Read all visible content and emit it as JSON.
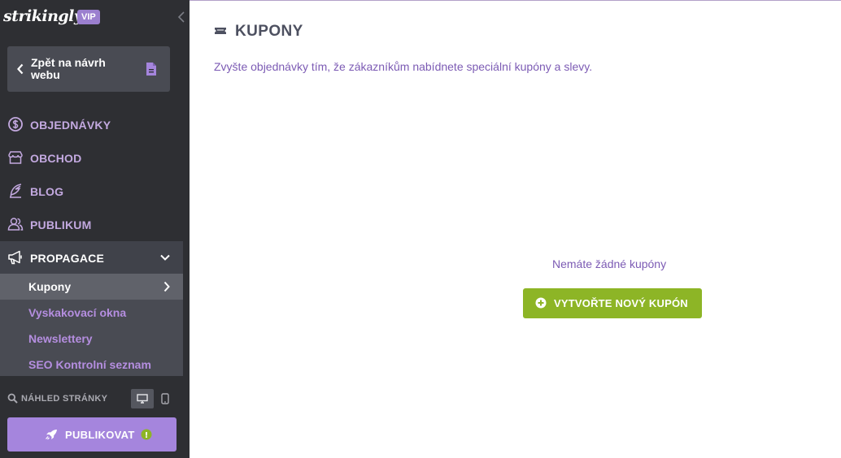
{
  "colors": {
    "sidebar_bg": "#2e2f33",
    "accent_purple": "#a585dd",
    "nav_text": "#c3a9e0",
    "create_button": "#8db526",
    "body_text_purple": "#7c5bb4"
  },
  "sidebar": {
    "logo": "strikingly",
    "badge": "VIP",
    "back_button": {
      "label": "Zpět na návrh webu",
      "icon": "page-icon"
    },
    "nav": [
      {
        "label": "OBJEDNÁVKY",
        "icon": "dollar-circle-icon"
      },
      {
        "label": "OBCHOD",
        "icon": "store-icon"
      },
      {
        "label": "BLOG",
        "icon": "feather-icon"
      },
      {
        "label": "PUBLIKUM",
        "icon": "users-icon"
      },
      {
        "label": "PROPAGACE",
        "icon": "megaphone-icon",
        "expanded": true
      }
    ],
    "submenu": [
      {
        "label": "Kupony",
        "active": true
      },
      {
        "label": "Vyskakovací okna"
      },
      {
        "label": "Newslettery"
      },
      {
        "label": "SEO Kontrolní seznam"
      }
    ],
    "preview": {
      "label": "NÁHLED STRÁNKY",
      "selected_device": "desktop"
    },
    "publish_button": {
      "label": "PUBLIKOVAT",
      "alert": "!"
    }
  },
  "main": {
    "title": "KUPONY",
    "title_icon": "coupon-icon",
    "description": "Zvyšte objednávky tím, že zákazníkům nabídnete speciální kupóny a slevy.",
    "empty_state": "Nemáte žádné kupóny",
    "create_button_label": "VYTVOŘTE NOVÝ KUPÓN"
  }
}
